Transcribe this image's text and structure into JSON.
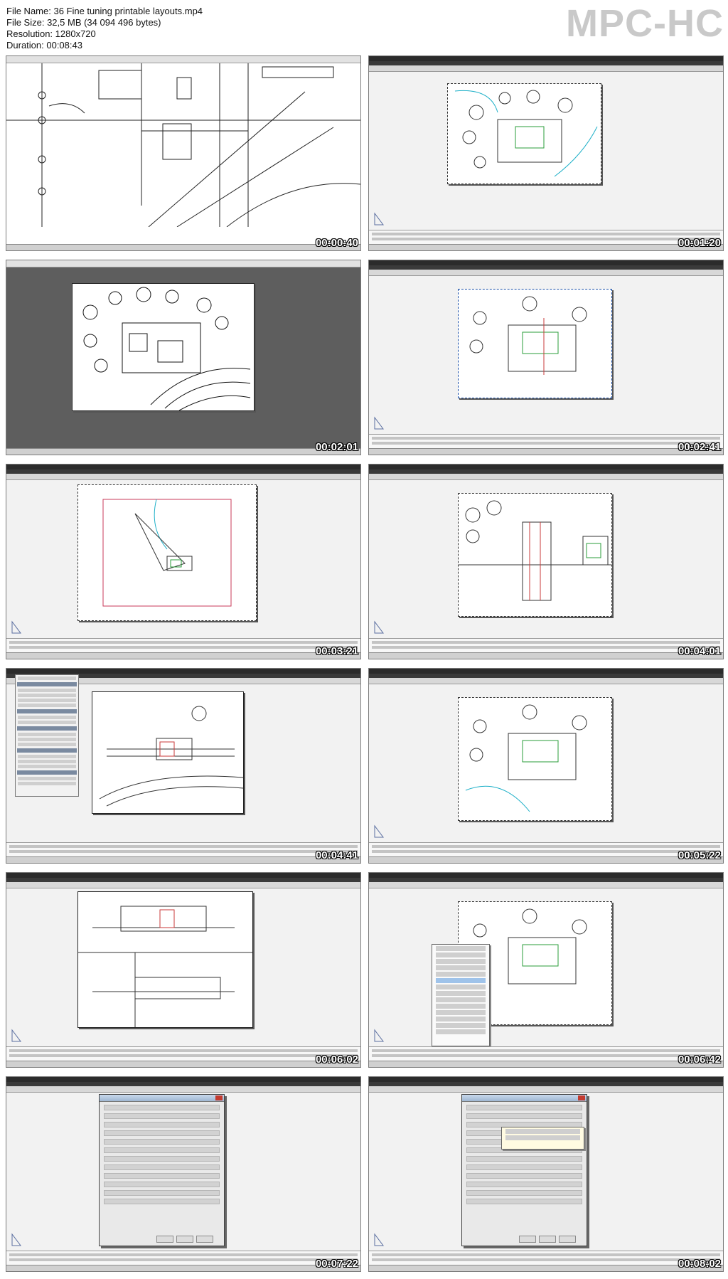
{
  "header": {
    "file_name_line": "File Name: 36 Fine tuning printable layouts.mp4",
    "file_size_line": "File Size: 32,5 MB (34 094 496 bytes)",
    "resolution_line": "Resolution: 1280x720",
    "duration_line": "Duration: 00:08:43"
  },
  "watermark": "MPC-HC",
  "thumbnails": [
    {
      "timestamp": "00:00:40"
    },
    {
      "timestamp": "00:01:20"
    },
    {
      "timestamp": "00:02:01"
    },
    {
      "timestamp": "00:02:41"
    },
    {
      "timestamp": "00:03:21"
    },
    {
      "timestamp": "00:04:01"
    },
    {
      "timestamp": "00:04:41"
    },
    {
      "timestamp": "00:05:22"
    },
    {
      "timestamp": "00:06:02"
    },
    {
      "timestamp": "00:06:42"
    },
    {
      "timestamp": "00:07:22"
    },
    {
      "timestamp": "00:08:02"
    }
  ]
}
